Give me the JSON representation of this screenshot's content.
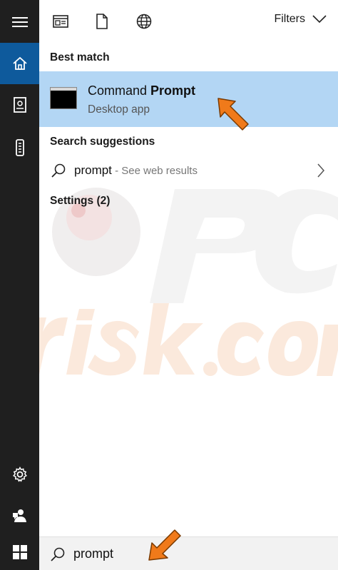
{
  "topbar": {
    "filters_label": "Filters",
    "icons": [
      "apps-icon",
      "documents-icon",
      "web-icon",
      "chevron-down-icon"
    ]
  },
  "rail": {
    "icons": [
      "hamburger-menu-icon",
      "home-icon",
      "notebook-icon",
      "device-icon",
      "settings-icon",
      "feedback-icon",
      "windows-start-icon"
    ],
    "active": "home-icon",
    "accent_color": "#0e5a9c"
  },
  "results": {
    "best_match_title": "Best match",
    "best_match": {
      "name_prefix": "Command ",
      "name_emphasis": "Prompt",
      "type": "Desktop app",
      "highlight_color": "#b3d6f4"
    },
    "suggestions_title": "Search suggestions",
    "suggestion": {
      "term": "prompt",
      "hint": " - See web results"
    },
    "settings_title": "Settings (2)"
  },
  "search": {
    "value": "prompt"
  },
  "annotations": {
    "arrow_color": "#f07a1a"
  }
}
